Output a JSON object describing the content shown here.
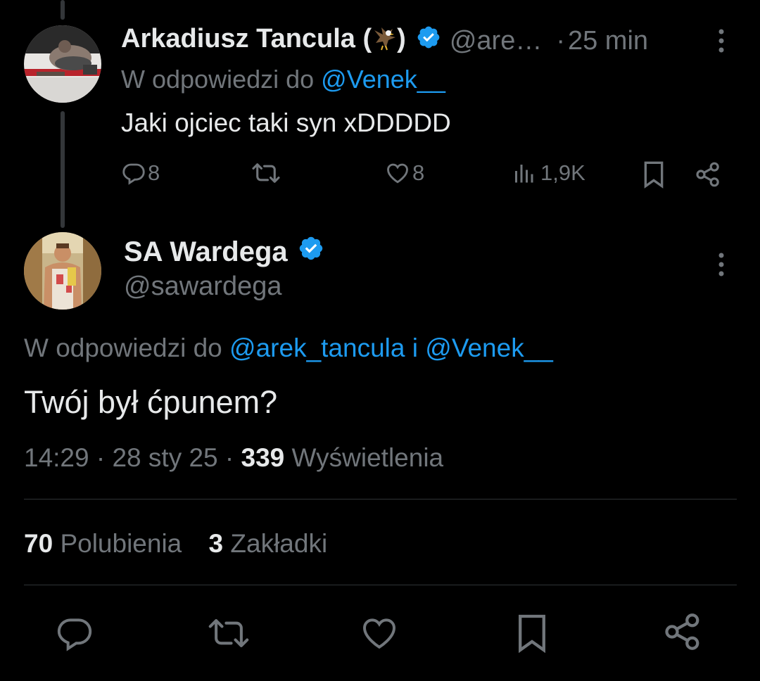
{
  "reply_post": {
    "display_name": "Arkadiusz Tancula",
    "name_emoji": "🦅",
    "handle": "@are…",
    "separator": "·",
    "time": "25 min",
    "reply_prefix": "W odpowiedzi do",
    "reply_to": "@Venek__",
    "text": "Jaki ojciec taki syn xDDDDD",
    "actions": {
      "replies": "8",
      "reposts": "",
      "likes": "8",
      "views": "1,9K"
    }
  },
  "main_post": {
    "display_name": "SA Wardega",
    "handle": "@sawardega",
    "reply_prefix": "W odpowiedzi do",
    "reply_to_1": "@arek_tancula",
    "reply_joiner": "i",
    "reply_to_2": "@Venek__",
    "text": "Twój był ćpunem?",
    "time": "14:29",
    "date": "28 sty 25",
    "dot": "·",
    "views_count": "339",
    "views_label": "Wyświetlenia",
    "likes_count": "70",
    "likes_label": "Polubienia",
    "bookmarks_count": "3",
    "bookmarks_label": "Zakładki"
  },
  "colors": {
    "background": "#000000",
    "text": "#e7e9ea",
    "secondary": "#71767b",
    "accent": "#1d9bf0",
    "divider": "#2f3336"
  }
}
